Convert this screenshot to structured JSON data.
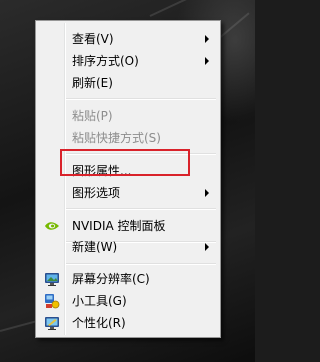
{
  "context_menu": {
    "items": [
      {
        "label": "查看(V)",
        "submenu": true,
        "enabled": true,
        "icon": ""
      },
      {
        "label": "排序方式(O)",
        "submenu": true,
        "enabled": true,
        "icon": ""
      },
      {
        "label": "刷新(E)",
        "submenu": false,
        "enabled": true,
        "icon": ""
      },
      {
        "label": "粘贴(P)",
        "submenu": false,
        "enabled": false,
        "icon": ""
      },
      {
        "label": "粘贴快捷方式(S)",
        "submenu": false,
        "enabled": false,
        "icon": ""
      },
      {
        "label": "图形属性...",
        "submenu": false,
        "enabled": true,
        "icon": ""
      },
      {
        "label": "图形选项",
        "submenu": true,
        "enabled": true,
        "icon": ""
      },
      {
        "label": "NVIDIA 控制面板",
        "submenu": false,
        "enabled": true,
        "icon": "nvidia-icon"
      },
      {
        "label": "新建(W)",
        "submenu": true,
        "enabled": true,
        "icon": ""
      },
      {
        "label": "屏幕分辨率(C)",
        "submenu": false,
        "enabled": true,
        "icon": "screen-resolution-icon"
      },
      {
        "label": "小工具(G)",
        "submenu": false,
        "enabled": true,
        "icon": "gadgets-icon"
      },
      {
        "label": "个性化(R)",
        "submenu": false,
        "enabled": true,
        "icon": "personalize-icon"
      }
    ]
  },
  "annotation": {
    "highlight_color": "#d9222a",
    "highlighted_item": "图形属性..."
  },
  "colors": {
    "menu_background": "#f0f0f0",
    "menu_border": "#979797",
    "disabled_text": "#8d8d8d",
    "nvidia_green": "#76b900"
  }
}
